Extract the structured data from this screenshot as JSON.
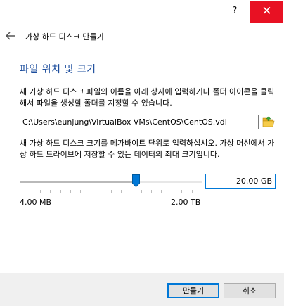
{
  "titlebar": {
    "help_label": "?",
    "close_label": "✕"
  },
  "header": {
    "title": "가상 하드 디스크 만들기"
  },
  "section": {
    "title": "파일 위치 및 크기",
    "location_description": "새 가상 하드 디스크 파일의 이름을 아래 상자에 입력하거나 폴더 아이콘을 클릭해서 파일을 생성할 폴더를 지정할 수 있습니다.",
    "file_path": "C:\\Users\\eunjung\\VirtualBox VMs\\CentOS\\CentOS.vdi",
    "size_description": "새 가상 하드 디스크 크기를 메가바이트 단위로 입력하십시오. 가상 머신에서 가상 하드 드라이브에 저장할 수 있는 데이터의 최대 크기입니다."
  },
  "size": {
    "value": "20.00 GB",
    "slider_fraction": 0.635,
    "min_label": "4.00 MB",
    "max_label": "2.00 TB"
  },
  "buttons": {
    "create": "만들기",
    "cancel": "취소"
  },
  "colors": {
    "accent": "#0078d7",
    "section_title": "#1b4c9c",
    "close_bg": "#e81123"
  },
  "icons": {
    "back": "back-arrow-icon",
    "folder": "folder-open-icon",
    "close": "close-icon",
    "help": "help-icon"
  }
}
